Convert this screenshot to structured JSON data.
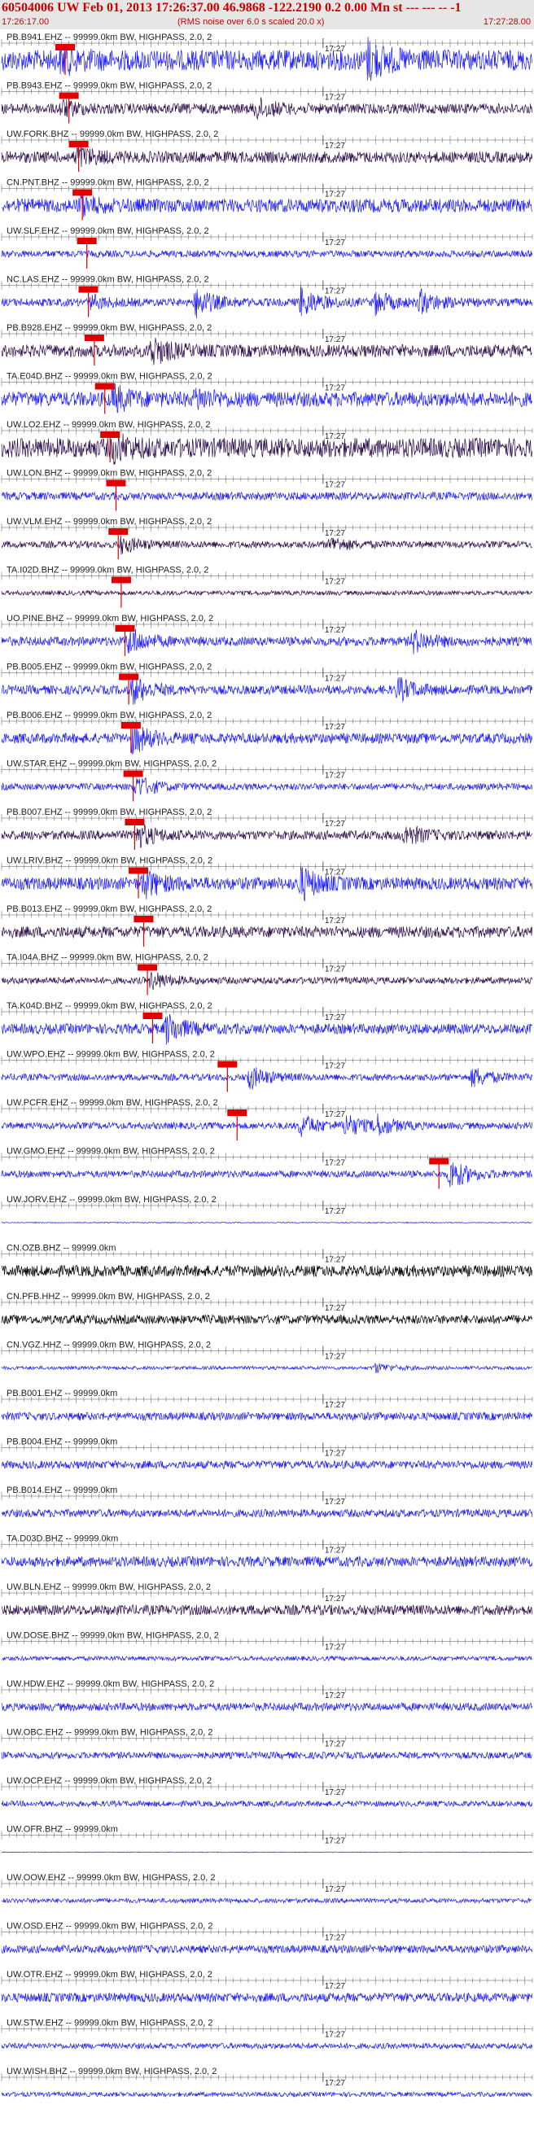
{
  "header": {
    "title": "60504006 UW Feb 01, 2013 17:26:37.00   46.9868 -122.2190  0.2 0.00 Mn st --- --- --   -1",
    "start_time": "17:26:17.00",
    "note": "(RMS noise over 6.0 s scaled 20.0 x)",
    "end_time": "17:27:28.00",
    "minute_mark": "17:27"
  },
  "colors": {
    "header_bg": "#e6e6e6",
    "header_text": "#cc0000",
    "blue_trace": "#1a1aff",
    "dark_trace": "#2b0a4a",
    "black_trace": "#000000",
    "pick": "#e00000"
  },
  "chart_data": {
    "type": "line",
    "time_range": [
      "17:26:17.00",
      "17:27:28.00"
    ],
    "x_tick_interval_s": 1,
    "minute_label": "17:27",
    "series": [
      {
        "label": "PB.B941.EHZ -- 99999.0km BW, HIGHPASS, 2.0, 2",
        "color": "blue",
        "amplitude": 0.9,
        "events": [
          [
            8,
            0.8
          ],
          [
            49,
            1.4
          ]
        ],
        "pick": 8.5
      },
      {
        "label": "PB.B943.EHZ -- 99999.0km BW, HIGHPASS, 2.0, 2",
        "color": "dark",
        "amplitude": 0.45,
        "events": [
          [
            8,
            0.6
          ],
          [
            34,
            0.8
          ]
        ],
        "pick": 9
      },
      {
        "label": "UW.FORK.BHZ -- 99999.0km BW, HIGHPASS, 2.0, 2",
        "color": "dark",
        "amplitude": 0.5,
        "events": [
          [
            10,
            0.8
          ]
        ],
        "pick": 10.3
      },
      {
        "label": "CN.PNT.BHZ -- 99999.0km BW, HIGHPASS, 2.0, 2",
        "color": "blue",
        "amplitude": 0.6,
        "events": [
          [
            10.5,
            0.6
          ]
        ],
        "pick": 10.8
      },
      {
        "label": "UW.SLF.EHZ -- 99999.0km BW, HIGHPASS, 2.0, 2",
        "color": "blue",
        "amplitude": 0.3,
        "events": [],
        "pick": 11.4
      },
      {
        "label": "NC.LAS.EHZ -- 99999.0km BW, HIGHPASS, 2.0, 2",
        "color": "blue",
        "amplitude": 0.35,
        "events": [
          [
            12,
            0.5
          ],
          [
            26,
            1.2
          ],
          [
            40,
            1.2
          ],
          [
            50,
            0.9
          ],
          [
            56,
            0.9
          ]
        ],
        "pick": 11.6
      },
      {
        "label": "PB.B928.EHZ -- 99999.0km BW, HIGHPASS, 2.0, 2",
        "color": "dark",
        "amplitude": 0.55,
        "events": [
          [
            20,
            1.1
          ]
        ],
        "pick": 12.4
      },
      {
        "label": "TA.E04D.BHZ -- 99999.0km BW, HIGHPASS, 2.0, 2",
        "color": "blue",
        "amplitude": 0.65,
        "events": [
          [
            15,
            0.9
          ],
          [
            26,
            0.7
          ]
        ],
        "pick": 13.8
      },
      {
        "label": "UW.LO2.EHZ -- 99999.0km BW, HIGHPASS, 2.0, 2",
        "color": "dark",
        "amplitude": 0.85,
        "events": [
          [
            15,
            0.8
          ]
        ],
        "pick": 14.5
      },
      {
        "label": "UW.LON.BHZ -- 99999.0km BW, HIGHPASS, 2.0, 2",
        "color": "blue",
        "amplitude": 0.35,
        "events": [],
        "pick": 15.3
      },
      {
        "label": "UW.VLM.EHZ -- 99999.0km BW, HIGHPASS, 2.0, 2",
        "color": "dark",
        "amplitude": 0.3,
        "events": [
          [
            16,
            0.7
          ],
          [
            44,
            0.6
          ]
        ],
        "pick": 15.6
      },
      {
        "label": "TA.I02D.BHZ -- 99999.0km BW, HIGHPASS, 2.0, 2",
        "color": "dark",
        "amplitude": 0.2,
        "events": [],
        "pick": 16
      },
      {
        "label": "UO.PINE.BHZ -- 99999.0km BW, HIGHPASS, 2.0, 2",
        "color": "blue",
        "amplitude": 0.4,
        "events": [
          [
            17,
            1.1
          ],
          [
            55,
            0.9
          ]
        ],
        "pick": 16.5
      },
      {
        "label": "PB.B005.EHZ -- 99999.0km BW, HIGHPASS, 2.0, 2",
        "color": "blue",
        "amplitude": 0.4,
        "events": [
          [
            17.5,
            1.1
          ],
          [
            53,
            0.9
          ]
        ],
        "pick": 17
      },
      {
        "label": "PB.B006.EHZ -- 99999.0km BW, HIGHPASS, 2.0, 2",
        "color": "blue",
        "amplitude": 0.45,
        "events": [
          [
            17.5,
            1.2
          ]
        ],
        "pick": 17.3
      },
      {
        "label": "UW.STAR.EHZ -- 99999.0km BW, HIGHPASS, 2.0, 2",
        "color": "blue",
        "amplitude": 0.3,
        "events": [
          [
            18,
            0.9
          ]
        ],
        "pick": 17.6
      },
      {
        "label": "PB.B007.EHZ -- 99999.0km BW, HIGHPASS, 2.0, 2",
        "color": "dark",
        "amplitude": 0.4,
        "events": [
          [
            18,
            1.0
          ],
          [
            54,
            0.8
          ]
        ],
        "pick": 17.8
      },
      {
        "label": "UW.LRIV.BHZ -- 99999.0km BW, HIGHPASS, 2.0, 2",
        "color": "blue",
        "amplitude": 0.55,
        "events": [
          [
            19,
            1.1
          ],
          [
            40,
            1.3
          ]
        ],
        "pick": 18.3
      },
      {
        "label": "PB.B013.EHZ -- 99999.0km BW, HIGHPASS, 2.0, 2",
        "color": "dark",
        "amplitude": 0.5,
        "events": [],
        "pick": 19
      },
      {
        "label": "TA.I04A.BHZ -- 99999.0km BW, HIGHPASS, 2.0, 2",
        "color": "dark",
        "amplitude": 0.3,
        "events": [
          [
            20,
            0.7
          ]
        ],
        "pick": 19.5
      },
      {
        "label": "TA.K04D.BHZ -- 99999.0km BW, HIGHPASS, 2.0, 2",
        "color": "blue",
        "amplitude": 0.45,
        "events": [
          [
            22,
            1.2
          ]
        ],
        "pick": 20.2
      },
      {
        "label": "UW.WPO.EHZ -- 99999.0km BW, HIGHPASS, 2.0, 2",
        "color": "blue",
        "amplitude": 0.3,
        "events": [
          [
            33,
            1.0
          ],
          [
            63,
            0.8
          ]
        ],
        "pick": 30.2
      },
      {
        "label": "UW.PCFR.EHZ -- 99999.0km BW, HIGHPASS, 2.0, 2",
        "color": "blue",
        "amplitude": 0.3,
        "events": [
          [
            40,
            0.9
          ],
          [
            46,
            0.9
          ],
          [
            50,
            0.8
          ]
        ],
        "pick": 31.5
      },
      {
        "label": "UW.GMO.EHZ -- 99999.0km BW, HIGHPASS, 2.0, 2",
        "color": "blue",
        "amplitude": 0.3,
        "events": [
          [
            60,
            1.3
          ]
        ],
        "pick": 58.5
      },
      {
        "label": "UW.JORV.EHZ -- 99999.0km BW, HIGHPASS, 2.0, 2",
        "color": "blue",
        "amplitude": 0.04,
        "events": [],
        "pick": null
      },
      {
        "label": "CN.OZB.BHZ -- 99999.0km",
        "color": "black",
        "amplitude": 0.5,
        "events": [],
        "pick": null
      },
      {
        "label": "CN.PFB.HHZ -- 99999.0km BW, HIGHPASS, 2.0, 2",
        "color": "black",
        "amplitude": 0.4,
        "events": [],
        "pick": null
      },
      {
        "label": "CN.VGZ.HHZ -- 99999.0km BW, HIGHPASS, 2.0, 2",
        "color": "blue",
        "amplitude": 0.15,
        "events": [
          [
            50,
            0.4
          ]
        ],
        "pick": null
      },
      {
        "label": "PB.B001.EHZ -- 99999.0km",
        "color": "blue",
        "amplitude": 0.35,
        "events": [],
        "pick": null
      },
      {
        "label": "PB.B004.EHZ -- 99999.0km",
        "color": "blue",
        "amplitude": 0.35,
        "events": [],
        "pick": null
      },
      {
        "label": "PB.B014.EHZ -- 99999.0km",
        "color": "blue",
        "amplitude": 0.35,
        "events": [],
        "pick": null
      },
      {
        "label": "TA.D03D.BHZ -- 99999.0km",
        "color": "blue",
        "amplitude": 0.45,
        "events": [],
        "pick": null
      },
      {
        "label": "UW.BLN.EHZ -- 99999.0km BW, HIGHPASS, 2.0, 2",
        "color": "dark",
        "amplitude": 0.45,
        "events": [],
        "pick": null
      },
      {
        "label": "UW.DOSE.BHZ -- 99999.0km BW, HIGHPASS, 2.0, 2",
        "color": "blue",
        "amplitude": 0.2,
        "events": [],
        "pick": null
      },
      {
        "label": "UW.HDW.EHZ -- 99999.0km BW, HIGHPASS, 2.0, 2",
        "color": "blue",
        "amplitude": 0.35,
        "events": [],
        "pick": null
      },
      {
        "label": "UW.OBC.EHZ -- 99999.0km BW, HIGHPASS, 2.0, 2",
        "color": "blue",
        "amplitude": 0.3,
        "events": [],
        "pick": null
      },
      {
        "label": "UW.OCP.EHZ -- 99999.0km BW, HIGHPASS, 2.0, 2",
        "color": "blue",
        "amplitude": 0.25,
        "events": [],
        "pick": null
      },
      {
        "label": "UW.OFR.BHZ -- 99999.0km",
        "color": "blue",
        "amplitude": 0.03,
        "events": [],
        "pick": null
      },
      {
        "label": "UW.OOW.EHZ -- 99999.0km BW, HIGHPASS, 2.0, 2",
        "color": "blue",
        "amplitude": 0.2,
        "events": [],
        "pick": null
      },
      {
        "label": "UW.OSD.EHZ -- 99999.0km BW, HIGHPASS, 2.0, 2",
        "color": "blue",
        "amplitude": 0.35,
        "events": [],
        "pick": null
      },
      {
        "label": "UW.OTR.EHZ -- 99999.0km BW, HIGHPASS, 2.0, 2",
        "color": "blue",
        "amplitude": 0.4,
        "events": [],
        "pick": null
      },
      {
        "label": "UW.STW.EHZ -- 99999.0km BW, HIGHPASS, 2.0, 2",
        "color": "blue",
        "amplitude": 0.25,
        "events": [],
        "pick": null
      },
      {
        "label": "UW.WISH.BHZ -- 99999.0km BW, HIGHPASS, 2.0, 2",
        "color": "blue",
        "amplitude": 0.2,
        "events": [],
        "pick": null
      }
    ]
  }
}
